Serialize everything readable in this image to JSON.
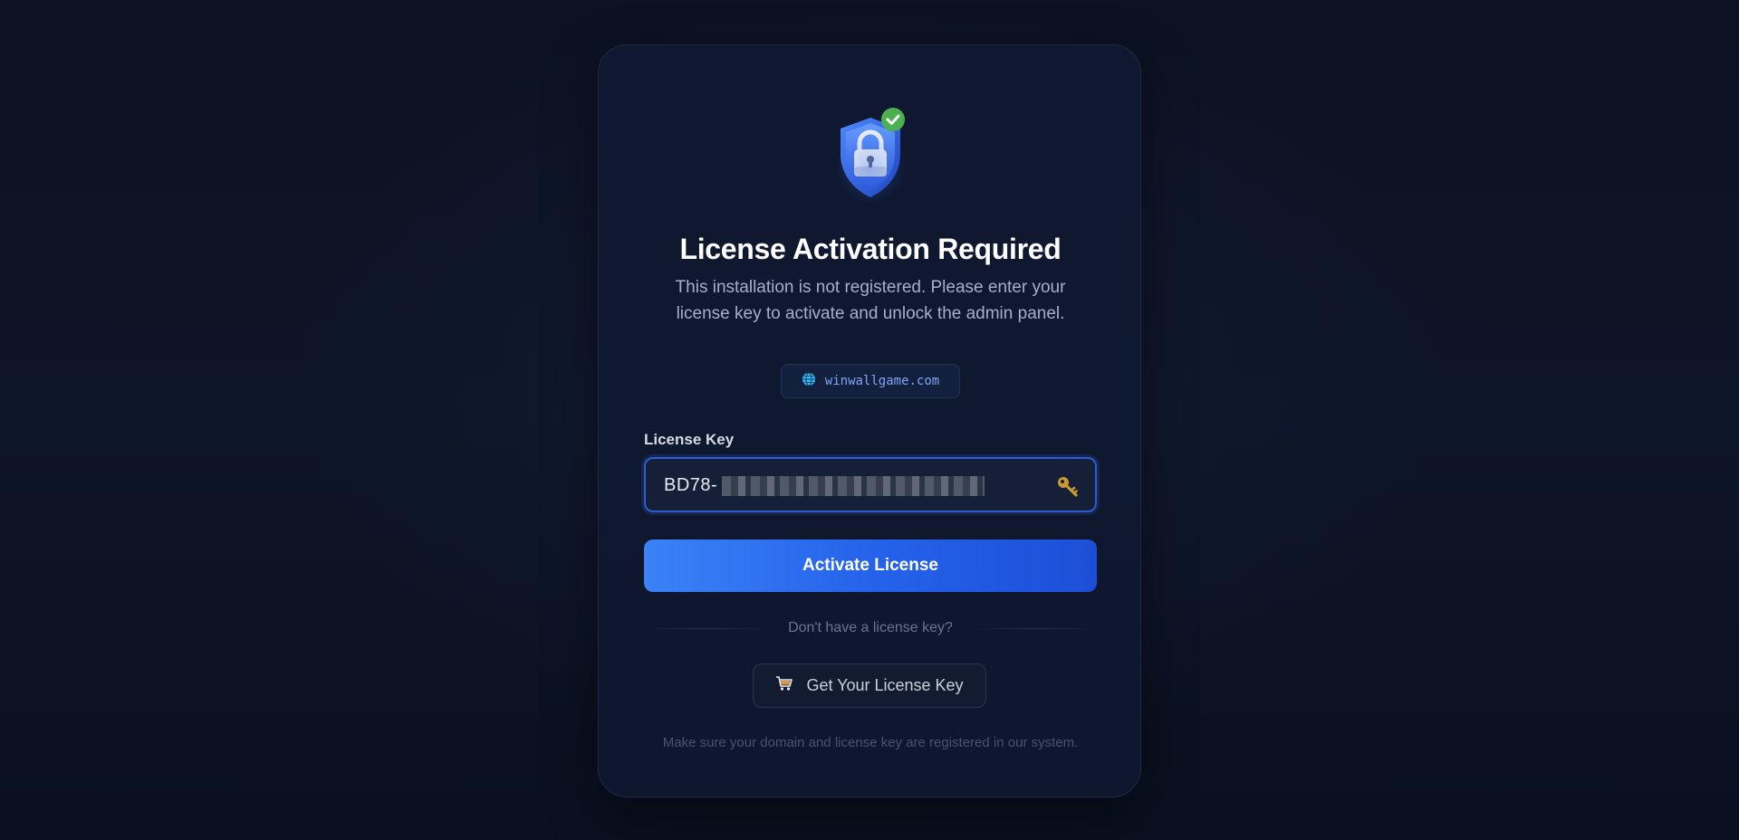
{
  "header": {
    "icon": "shield-lock-check-icon",
    "title": "License Activation Required",
    "subtitle": "This installation is not registered. Please enter your license key to activate and unlock the admin panel."
  },
  "domain": {
    "icon": "globe-icon",
    "text": "winwallgame.com"
  },
  "form": {
    "license_label": "License Key",
    "license_value": "BD78-",
    "license_icon": "key-icon",
    "activate_label": "Activate License"
  },
  "alt": {
    "divider_text": "Don't have a license key?",
    "get_key_label": "Get Your License Key",
    "get_key_icon": "cart-icon"
  },
  "footer": {
    "note": "Make sure your domain and license key are registered in our system."
  },
  "colors": {
    "accent": "#3b82f6",
    "accent_dark": "#1d4ed8",
    "success": "#4caf50",
    "background": "#0b1120",
    "card": "#0f1830"
  }
}
